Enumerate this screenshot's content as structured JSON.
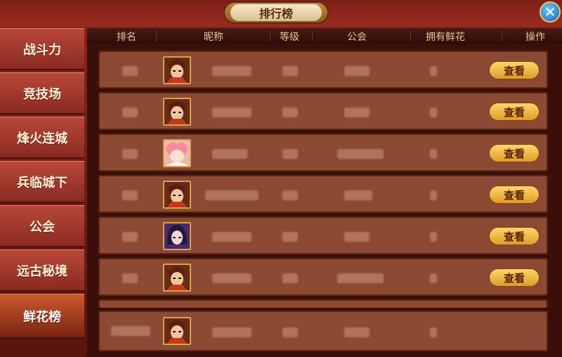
{
  "window": {
    "title": "排行榜",
    "close_icon": "close-icon"
  },
  "sidebar": {
    "items": [
      {
        "label": "战斗力",
        "active": false
      },
      {
        "label": "竞技场",
        "active": false
      },
      {
        "label": "烽火连城",
        "active": false
      },
      {
        "label": "兵临城下",
        "active": false
      },
      {
        "label": "公会",
        "active": false
      },
      {
        "label": "远古秘境",
        "active": false
      },
      {
        "label": "鲜花榜",
        "active": true
      }
    ]
  },
  "table": {
    "headers": [
      "排名",
      "昵称",
      "等级",
      "公会",
      "拥有鲜花",
      "操作"
    ],
    "rows": [
      {
        "avatar": "warrior-avatar",
        "action": "查看"
      },
      {
        "avatar": "warrior-avatar",
        "action": "查看"
      },
      {
        "avatar": "pink-girl-avatar",
        "action": "查看"
      },
      {
        "avatar": "warrior-avatar",
        "action": "查看"
      },
      {
        "avatar": "dark-hair-girl-avatar",
        "action": "查看"
      },
      {
        "avatar": "warrior-avatar",
        "action": "查看"
      }
    ]
  },
  "self_row": {
    "avatar": "warrior-avatar"
  },
  "colors": {
    "accent": "#d8a24a",
    "button": "#f2b840",
    "panel": "#8c4a34",
    "sidebar": "#a83a2c"
  }
}
